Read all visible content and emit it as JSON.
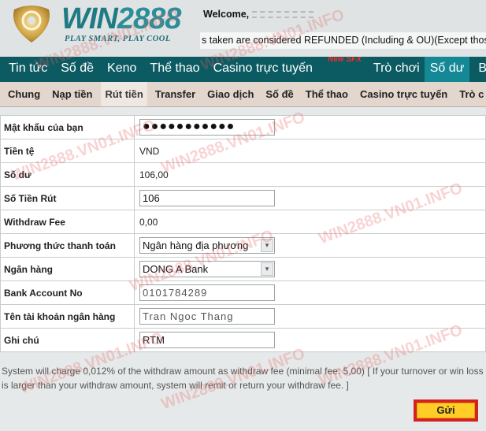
{
  "header": {
    "logo_text_word": "WIN",
    "logo_text_nums": "2888",
    "tagline": "PLAY SMART, PLAY COOL",
    "welcome_label": "Welcome,",
    "ticker_text": "s taken are considered REFUNDED (Including & OU)(Except those"
  },
  "main_nav": {
    "items": [
      {
        "label": "Tin tức"
      },
      {
        "label": "Số đề"
      },
      {
        "label": "Keno"
      },
      {
        "label": "Thể thao"
      },
      {
        "label": "Casino trực tuyến",
        "badge": "New SFX"
      },
      {
        "label": "Trò chơi"
      },
      {
        "label": "Số dư",
        "active": true
      },
      {
        "label": "Ba"
      }
    ]
  },
  "sub_nav": {
    "items": [
      {
        "label": "Chung"
      },
      {
        "label": "Nạp tiền"
      },
      {
        "label": "Rút tiền",
        "active": true
      },
      {
        "label": "Transfer"
      },
      {
        "label": "Giao dịch"
      },
      {
        "label": "Số đề"
      },
      {
        "label": "Thể thao"
      },
      {
        "label": "Casino trực tuyến"
      },
      {
        "label": "Trò c"
      }
    ]
  },
  "form": {
    "rows": [
      {
        "label": "Mật khẩu của bạn",
        "type": "password",
        "value": "●●●●●●●●●●●"
      },
      {
        "label": "Tiền tệ",
        "type": "text",
        "value": "VND"
      },
      {
        "label": "Số dư",
        "type": "text",
        "value": "106,00"
      },
      {
        "label": "Số Tiền Rút",
        "type": "input",
        "value": "106"
      },
      {
        "label": "Withdraw Fee",
        "type": "text",
        "value": "0,00"
      },
      {
        "label": "Phương thức thanh toán",
        "type": "select",
        "value": "Ngân hàng địa phương"
      },
      {
        "label": "Ngân hàng",
        "type": "select",
        "value": "DONG A Bank"
      },
      {
        "label": "Bank Account No",
        "type": "input",
        "value": "0101784289"
      },
      {
        "label": "Tên tài khoản ngân hàng",
        "type": "input",
        "value": "Tran Ngoc Thang"
      },
      {
        "label": "Ghi chú",
        "type": "input",
        "value": "RTM"
      }
    ]
  },
  "note": "System will charge 0,012% of the withdraw amount as withdraw fee (minimal fee: 5,00) [ If your turnover or win loss is larger than your withdraw amount, system will remit or return your withdraw fee. ]",
  "submit_label": "Gửi",
  "watermark": "WIN2888.VN01.INFO",
  "colors": {
    "main_nav_bg": "#0c5b63",
    "main_nav_active": "#158896",
    "sub_nav_bg": "#e2d6cd",
    "submit_bg": "#ffcd25",
    "submit_highlight": "#d42222",
    "badge_new": "#ff2a2a"
  }
}
